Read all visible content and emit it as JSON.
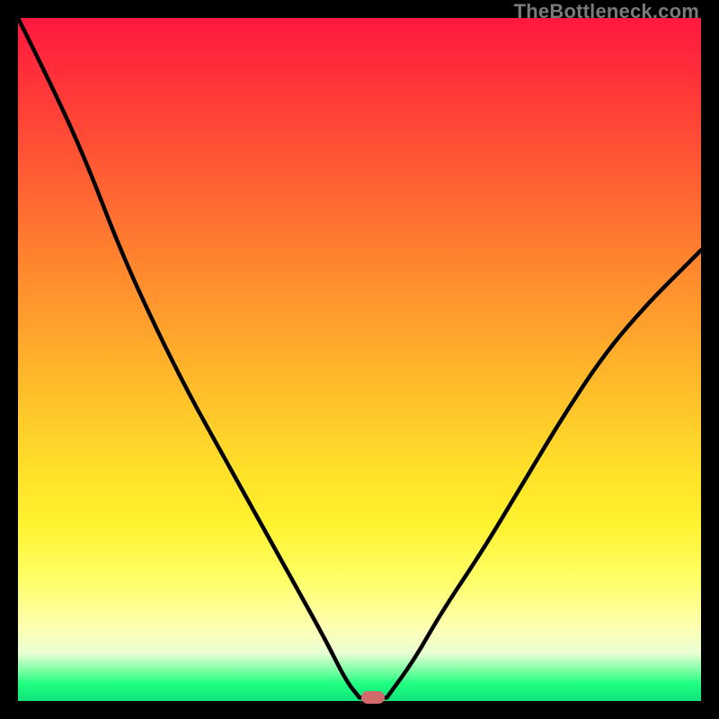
{
  "attribution": "TheBottleneck.com",
  "colors": {
    "frame": "#000000",
    "gradient_top": "#ff183f",
    "gradient_mid": "#ffdd29",
    "gradient_bottom": "#12e27a",
    "curve": "#000000",
    "marker": "#d36a6a",
    "attribution_text": "#7a7a7a"
  },
  "chart_data": {
    "type": "line",
    "title": "",
    "xlabel": "",
    "ylabel": "",
    "xlim": [
      0,
      100
    ],
    "ylim": [
      0,
      100
    ],
    "grid": false,
    "legend": false,
    "note": "x is normalized horizontal position (% of plot width), y is normalized height (% of plot), 0 = bottom. Values estimated from pixels.",
    "series": [
      {
        "name": "left-branch",
        "x": [
          0,
          5,
          10,
          15,
          20,
          25,
          30,
          35,
          40,
          45,
          48,
          50
        ],
        "y": [
          100,
          90,
          79,
          66,
          55,
          45,
          36,
          27,
          18,
          9,
          3,
          0.5
        ]
      },
      {
        "name": "flat",
        "x": [
          50,
          52,
          54
        ],
        "y": [
          0.5,
          0.5,
          0.5
        ]
      },
      {
        "name": "right-branch",
        "x": [
          54,
          58,
          62,
          68,
          74,
          80,
          86,
          92,
          98,
          100
        ],
        "y": [
          0.5,
          6,
          13,
          22,
          32,
          42,
          51,
          58,
          64,
          66
        ]
      }
    ],
    "marker": {
      "x": 52,
      "y": 0.5,
      "shape": "rounded-rect"
    }
  }
}
